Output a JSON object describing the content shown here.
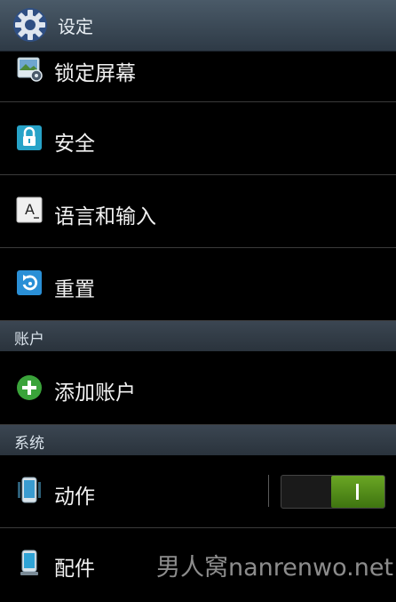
{
  "header": {
    "title": "设定",
    "icon": "gear-icon"
  },
  "items": [
    {
      "label": "锁定屏幕",
      "icon": "lock-screen-icon"
    },
    {
      "label": "安全",
      "icon": "padlock-icon"
    },
    {
      "label": "语言和输入",
      "icon": "language-icon",
      "glyph": "A"
    },
    {
      "label": "重置",
      "icon": "reset-icon"
    }
  ],
  "sections": {
    "accounts": {
      "label": "账户"
    },
    "system": {
      "label": "系统"
    }
  },
  "accounts": {
    "add_label": "添加账户",
    "icon": "plus-circle-icon"
  },
  "system": {
    "motion_label": "动作",
    "motion_enabled": true,
    "toggle_on_glyph": "I",
    "accessory_label": "配件"
  },
  "watermark": "男人窝nanrenwo.net",
  "colors": {
    "toggle_on": "#5a9a1e",
    "section_bg": "#33404b"
  }
}
